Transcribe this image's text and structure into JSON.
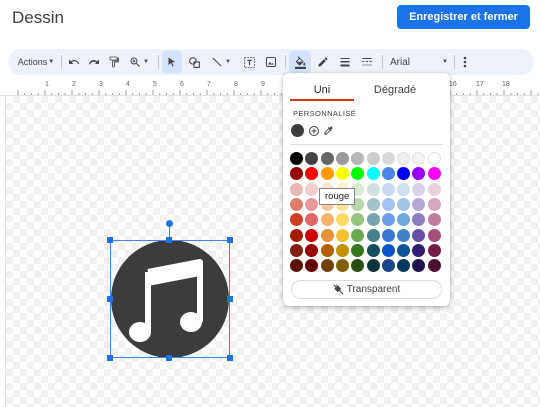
{
  "app": {
    "title": "Dessin",
    "save_label": "Enregistrer et fermer"
  },
  "toolbar": {
    "actions_label": "Actions",
    "font_name": "Arial",
    "icons": [
      "undo-icon",
      "redo-icon",
      "paint-format-icon",
      "zoom-icon",
      "select-icon",
      "shape-icon",
      "line-icon",
      "textbox-icon",
      "image-icon",
      "fill-color-icon",
      "border-color-icon",
      "border-weight-icon",
      "border-dash-icon",
      "more-icon"
    ]
  },
  "ruler": {
    "numbers": [
      "1",
      "2",
      "3",
      "4",
      "5",
      "6",
      "7",
      "8",
      "9",
      "16",
      "17",
      "18"
    ]
  },
  "color_popup": {
    "tab_solid": "Uni",
    "tab_gradient": "Dégradé",
    "custom_label": "PERSONNALISÉ",
    "custom_color": "#3c3c3c",
    "tooltip": "rouge",
    "transparent_label": "Transparent",
    "palette_rows": [
      [
        "#000000",
        "#434343",
        "#666666",
        "#999999",
        "#b7b7b7",
        "#cccccc",
        "#d9d9d9",
        "#efefef",
        "#f3f3f3",
        "#ffffff"
      ],
      [
        "#980000",
        "#ff0000",
        "#ff9900",
        "#ffff00",
        "#00ff00",
        "#00ffff",
        "#4a86e8",
        "#0000ff",
        "#9900ff",
        "#ff00ff"
      ],
      [
        "#e6b8af",
        "#f4cccc",
        "#fce5cd",
        "#fff2cc",
        "#d9ead3",
        "#d0e0e3",
        "#c9daf8",
        "#cfe2f3",
        "#d9d2e9",
        "#ead1dc"
      ],
      [
        "#dd7e6b",
        "#ea9999",
        "#f9cb9c",
        "#ffe599",
        "#b6d7a8",
        "#a2c4c9",
        "#a4c2f4",
        "#9fc5e8",
        "#b4a7d6",
        "#d5a6bd"
      ],
      [
        "#cc4125",
        "#e06666",
        "#f6b26b",
        "#ffd966",
        "#93c47d",
        "#76a5af",
        "#6d9eeb",
        "#6fa8dc",
        "#8e7cc3",
        "#c27ba0"
      ],
      [
        "#a61c00",
        "#cc0000",
        "#e69138",
        "#f1c232",
        "#6aa84f",
        "#45818e",
        "#3c78d8",
        "#3d85c6",
        "#674ea7",
        "#a64d79"
      ],
      [
        "#85200c",
        "#990000",
        "#b45f06",
        "#bf9000",
        "#38761d",
        "#134f5c",
        "#1155cc",
        "#0b5394",
        "#351c75",
        "#741b47"
      ],
      [
        "#5b0f00",
        "#660000",
        "#783f04",
        "#7f6000",
        "#274e13",
        "#0c343d",
        "#1c4587",
        "#073763",
        "#20124d",
        "#4c1130"
      ]
    ]
  },
  "drawing": {
    "icon": "music-note-icon",
    "circle_color": "#3c3c3c",
    "note_color": "#ffffff",
    "selection_color": "#1a73e8"
  }
}
